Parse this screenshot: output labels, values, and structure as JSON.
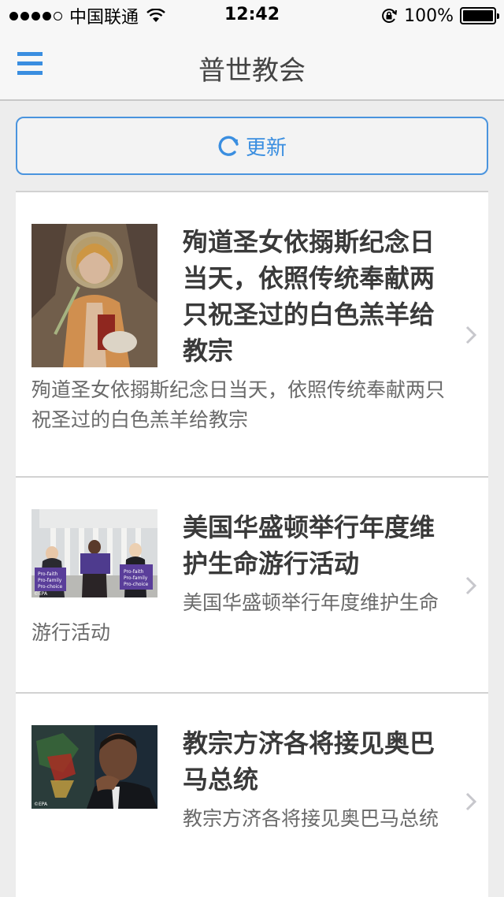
{
  "status_bar": {
    "carrier": "中国联通",
    "time": "12:42",
    "battery_percent": "100%"
  },
  "nav": {
    "title": "普世教会"
  },
  "refresh": {
    "label": "更新"
  },
  "articles": [
    {
      "title": "殉道圣女依搦斯纪念日当天，依照传统奉献两只祝圣过的白色羔羊给教宗",
      "summary": "殉道圣女依搦斯纪念日当天，依照传统奉献两只祝圣过的白色羔羊给教宗"
    },
    {
      "title": "美国华盛顿举行年度维护生命游行活动",
      "summary": "美国华盛顿举行年度维护生命游行活动",
      "sign_texts": [
        "Pro-faith",
        "Pro-family",
        "Pro-choice"
      ],
      "credit": "©EPA"
    },
    {
      "title": "教宗方济各将接见奥巴马总统",
      "summary": "教宗方济各将接见奥巴马总统",
      "credit": "©EPA"
    }
  ],
  "colors": {
    "accent": "#3a8ee0",
    "nav_bg": "#f7f7f7",
    "page_bg": "#ededed"
  }
}
